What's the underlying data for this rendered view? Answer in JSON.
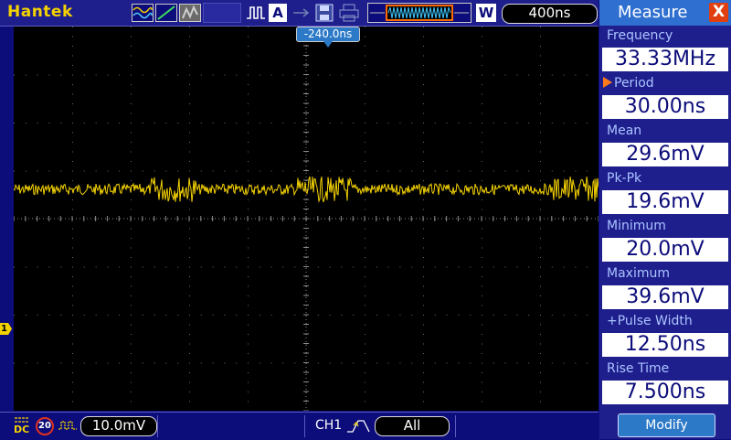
{
  "brand": "Hantek",
  "toolbar": {
    "icons": [
      "waveform-mode-icon",
      "waveform-shape-icon",
      "persist-icon",
      "pulse-icon",
      "auto-icon",
      "arrow-icon",
      "save-icon",
      "print-icon",
      "memory-waveform-icon",
      "wave-overview-icon",
      "window-icon"
    ],
    "auto_label": "A",
    "window_label": "W",
    "timebase": "400ns"
  },
  "trigger": {
    "position_label": "-240.0ns"
  },
  "channel": {
    "marker_label": "1",
    "coupling": "DC",
    "bw_limit": "20",
    "volts_div": "10.0mV",
    "trigger_source": "CH1",
    "trigger_mode": "All",
    "trace_color": "#f4d200"
  },
  "measure": {
    "title": "Measure",
    "close_label": "X",
    "items": [
      {
        "label": "Frequency",
        "value": "33.33MHz",
        "selected": false
      },
      {
        "label": "Period",
        "value": "30.00ns",
        "selected": true
      },
      {
        "label": "Mean",
        "value": "29.6mV",
        "selected": false
      },
      {
        "label": "Pk-Pk",
        "value": "19.6mV",
        "selected": false
      },
      {
        "label": "Minimum",
        "value": "20.0mV",
        "selected": false
      },
      {
        "label": "Maximum",
        "value": "39.6mV",
        "selected": false
      },
      {
        "label": "+Pulse Width",
        "value": "12.50ns",
        "selected": false
      },
      {
        "label": "Rise Time",
        "value": "7.500ns",
        "selected": false
      }
    ],
    "modify_label": "Modify"
  },
  "colors": {
    "background": "#0c0c7a",
    "brand": "#f4d200",
    "accent": "#2c79c8",
    "close": "#e04010"
  }
}
